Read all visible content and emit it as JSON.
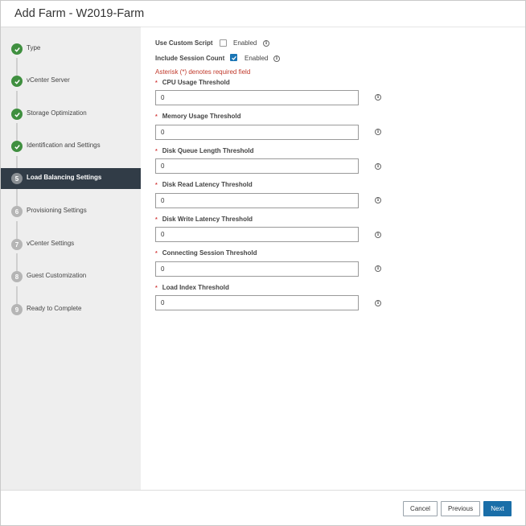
{
  "dialog": {
    "title": "Add Farm - W2019-Farm"
  },
  "steps": [
    {
      "number": "1",
      "label": "Type",
      "state": "done"
    },
    {
      "number": "2",
      "label": "vCenter Server",
      "state": "done"
    },
    {
      "number": "3",
      "label": "Storage Optimization",
      "state": "done"
    },
    {
      "number": "4",
      "label": "Identification and Settings",
      "state": "done"
    },
    {
      "number": "5",
      "label": "Load Balancing Settings",
      "state": "current"
    },
    {
      "number": "6",
      "label": "Provisioning Settings",
      "state": "pending"
    },
    {
      "number": "7",
      "label": "vCenter Settings",
      "state": "pending"
    },
    {
      "number": "8",
      "label": "Guest Customization",
      "state": "pending"
    },
    {
      "number": "9",
      "label": "Ready to Complete",
      "state": "pending"
    }
  ],
  "form": {
    "custom_script": {
      "label": "Use Custom Script",
      "checkbox_label": "Enabled",
      "checked": false
    },
    "session_count": {
      "label": "Include Session Count",
      "checkbox_label": "Enabled",
      "checked": true
    },
    "required_note": "Asterisk (*) denotes required field",
    "asterisk": "*",
    "info_glyph": "i",
    "fields": [
      {
        "label": "CPU Usage Threshold",
        "value": "0"
      },
      {
        "label": "Memory Usage Threshold",
        "value": "0"
      },
      {
        "label": "Disk Queue Length Threshold",
        "value": "0"
      },
      {
        "label": "Disk Read Latency Threshold",
        "value": "0"
      },
      {
        "label": "Disk Write Latency Threshold",
        "value": "0"
      },
      {
        "label": "Connecting Session Threshold",
        "value": "0"
      },
      {
        "label": "Load Index Threshold",
        "value": "0"
      }
    ]
  },
  "footer": {
    "cancel_label": "Cancel",
    "previous_label": "Previous",
    "next_label": "Next"
  },
  "colors": {
    "accent": "#1a6ea8",
    "sidebar_active": "#313c47",
    "done": "#3f8f3f",
    "required": "#c0392b"
  }
}
